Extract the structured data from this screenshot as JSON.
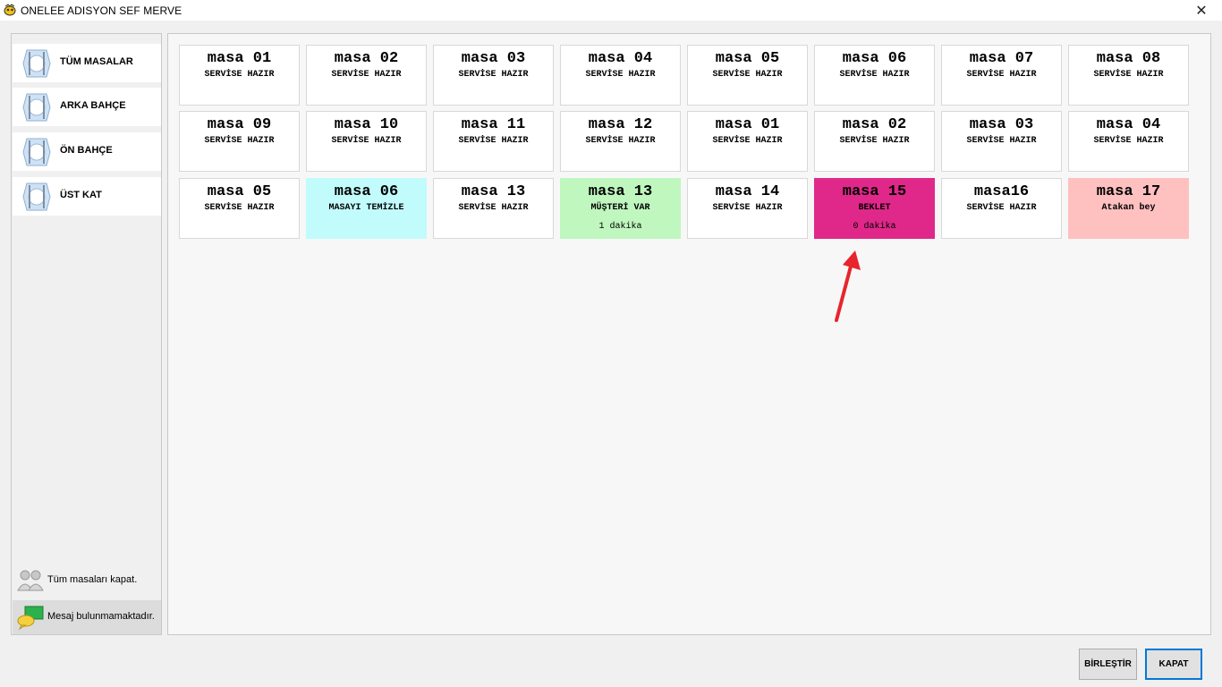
{
  "window": {
    "title": "ONELEE ADISYON SEF MERVE",
    "close_symbol": "✕"
  },
  "sidebar": {
    "items": [
      {
        "label": "TÜM MASALAR",
        "icon": "cutlery-icon"
      },
      {
        "label": "ARKA BAHÇE",
        "icon": "cutlery-icon"
      },
      {
        "label": "ÖN BAHÇE",
        "icon": "cutlery-icon"
      },
      {
        "label": "ÜST KAT",
        "icon": "cutlery-icon"
      }
    ],
    "close_all_label": "Tüm masaları kapat.",
    "message_label": "Mesaj bulunmamaktadır."
  },
  "tables": [
    {
      "name": "masa 01",
      "status": "SERVİSE HAZIR",
      "time": "",
      "color": "#ffffff"
    },
    {
      "name": "masa 02",
      "status": "SERVİSE HAZIR",
      "time": "",
      "color": "#ffffff"
    },
    {
      "name": "masa 03",
      "status": "SERVİSE HAZIR",
      "time": "",
      "color": "#ffffff"
    },
    {
      "name": "masa 04",
      "status": "SERVİSE HAZIR",
      "time": "",
      "color": "#ffffff"
    },
    {
      "name": "masa 05",
      "status": "SERVİSE HAZIR",
      "time": "",
      "color": "#ffffff"
    },
    {
      "name": "masa 06",
      "status": "SERVİSE HAZIR",
      "time": "",
      "color": "#ffffff"
    },
    {
      "name": "masa 07",
      "status": "SERVİSE HAZIR",
      "time": "",
      "color": "#ffffff"
    },
    {
      "name": "masa 08",
      "status": "SERVİSE HAZIR",
      "time": "",
      "color": "#ffffff"
    },
    {
      "name": "masa 09",
      "status": "SERVİSE HAZIR",
      "time": "",
      "color": "#ffffff"
    },
    {
      "name": "masa 10",
      "status": "SERVİSE HAZIR",
      "time": "",
      "color": "#ffffff"
    },
    {
      "name": "masa 11",
      "status": "SERVİSE HAZIR",
      "time": "",
      "color": "#ffffff"
    },
    {
      "name": "masa 12",
      "status": "SERVİSE HAZIR",
      "time": "",
      "color": "#ffffff"
    },
    {
      "name": "masa 01",
      "status": "SERVİSE HAZIR",
      "time": "",
      "color": "#ffffff"
    },
    {
      "name": "masa 02",
      "status": "SERVİSE HAZIR",
      "time": "",
      "color": "#ffffff"
    },
    {
      "name": "masa 03",
      "status": "SERVİSE HAZIR",
      "time": "",
      "color": "#ffffff"
    },
    {
      "name": "masa 04",
      "status": "SERVİSE HAZIR",
      "time": "",
      "color": "#ffffff"
    },
    {
      "name": "masa 05",
      "status": "SERVİSE HAZIR",
      "time": "",
      "color": "#ffffff"
    },
    {
      "name": "masa 06",
      "status": "MASAYI TEMİZLE",
      "time": "",
      "color": "#c2fbfc"
    },
    {
      "name": "masa 13",
      "status": "SERVİSE HAZIR",
      "time": "",
      "color": "#ffffff"
    },
    {
      "name": "masa 13",
      "status": "MÜŞTERİ VAR",
      "time": "1 dakika",
      "color": "#bff7bf"
    },
    {
      "name": "masa 14",
      "status": "SERVİSE HAZIR",
      "time": "",
      "color": "#ffffff"
    },
    {
      "name": "masa 15",
      "status": "BEKLET",
      "time": "0 dakika",
      "color": "#e0288a"
    },
    {
      "name": "masa16",
      "status": "SERVİSE HAZIR",
      "time": "",
      "color": "#ffffff"
    },
    {
      "name": "masa 17",
      "status": "Atakan bey",
      "time": "",
      "color": "#ffc0c0"
    }
  ],
  "buttons": {
    "merge_label": "BİRLEŞTİR",
    "close_label": "KAPAT"
  },
  "annotation_color": "#e8242c"
}
